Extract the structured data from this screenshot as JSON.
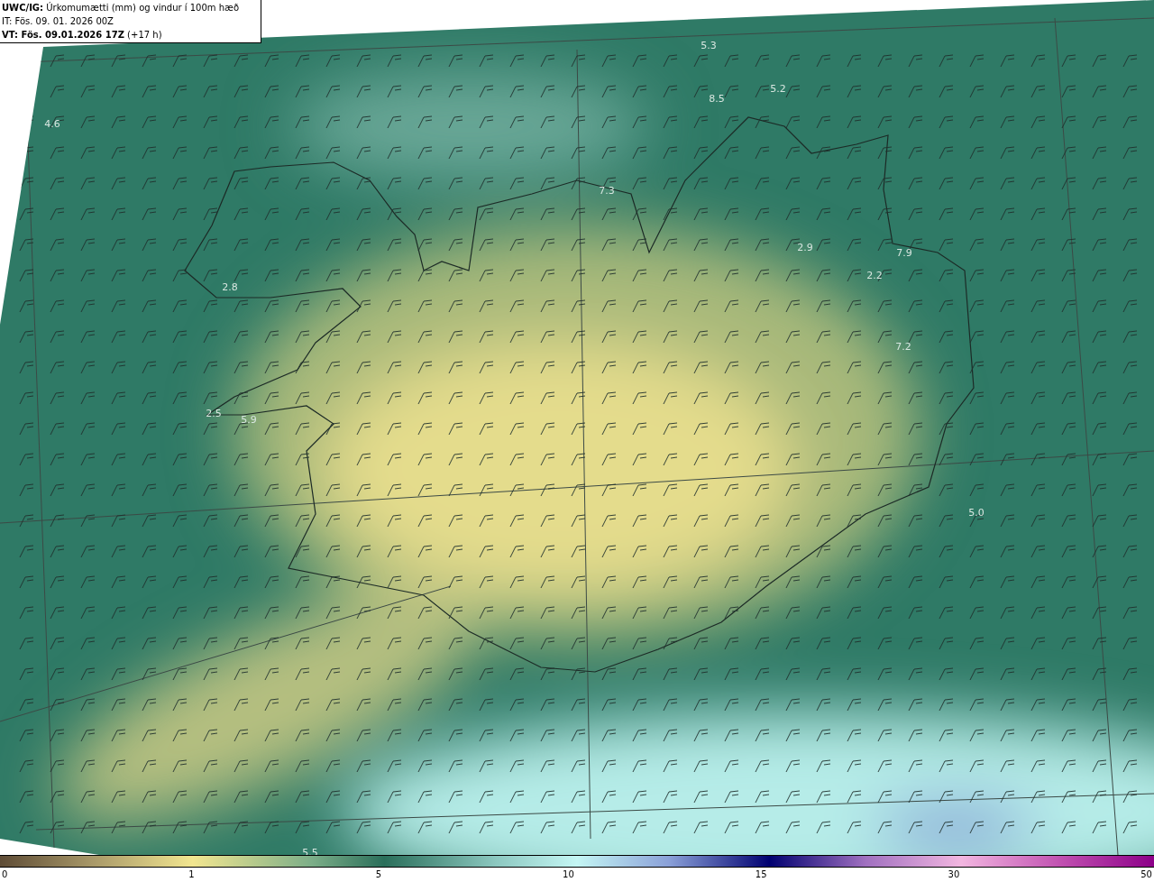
{
  "header": {
    "lines": [
      "**UWC/IG:** Úrkomumætti (mm) og vindur í 100m hæð",
      "IT: Fös. 09. 01. 2026 00Z",
      "**VT: Fös. 09.01.2026 17Z** (+17 h)"
    ]
  },
  "map": {
    "values": [
      "4.6",
      "5.3",
      "5.2",
      "8.5",
      "7.3",
      "2.8",
      "2.5",
      "5.9",
      "2.9",
      "7.9",
      "2.2",
      "7.2",
      "5.0",
      "5.5"
    ]
  },
  "colorbar": {
    "ticks": [
      "0",
      "1",
      "5",
      "10",
      "15",
      "30",
      "50"
    ]
  }
}
